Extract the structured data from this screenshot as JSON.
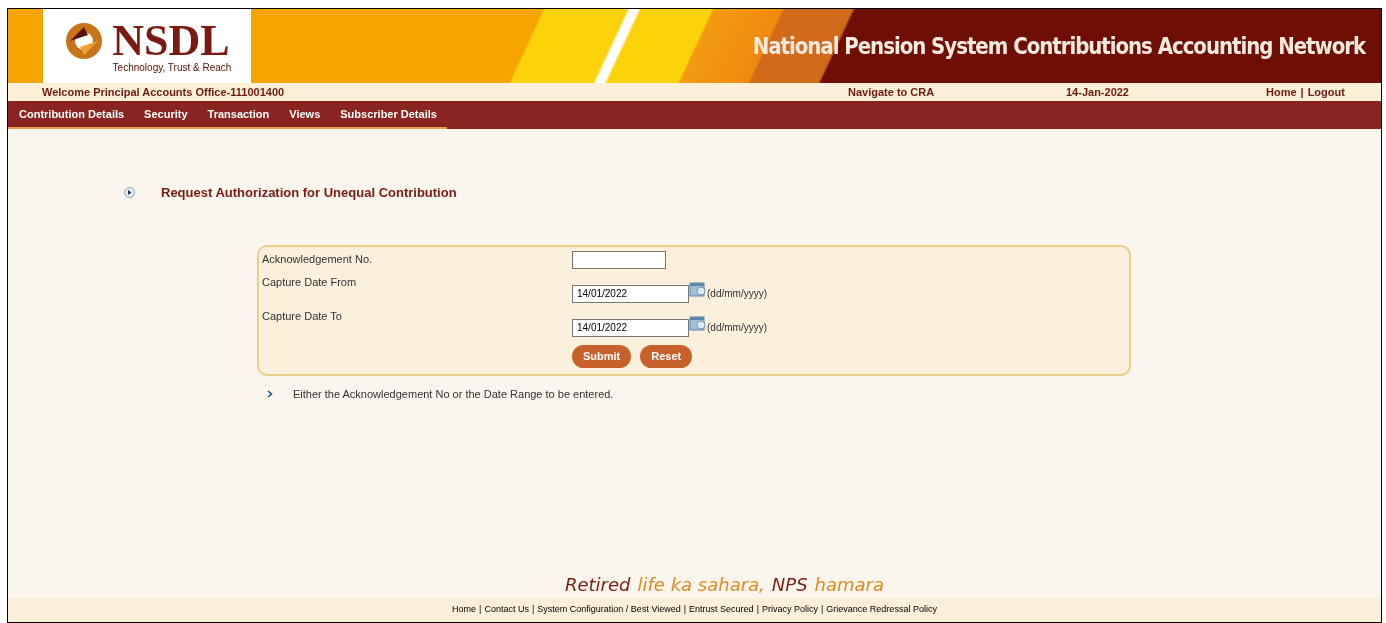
{
  "header": {
    "logo_text": "NSDL",
    "logo_tagline": "Technology, Trust & Reach",
    "title": "National Pension System Contributions Accounting Network"
  },
  "info_bar": {
    "welcome": "Welcome Principal Accounts Office-111001400",
    "navigate": "Navigate to CRA",
    "date": "14-Jan-2022",
    "links": [
      "Home",
      "Logout"
    ],
    "separator": "|"
  },
  "menu": [
    "Contribution Details",
    "Security",
    "Transaction",
    "Views",
    "Subscriber Details"
  ],
  "page_title": "Request Authorization for Unequal Contribution",
  "form": {
    "fields": [
      {
        "kind": "text",
        "label": "Acknowledgement No."
      },
      {
        "kind": "date",
        "label": "Capture Date From",
        "value": "14/01/2022",
        "hint": "(dd/mm/yyyy)"
      },
      {
        "kind": "date",
        "label": "Capture Date To",
        "value": "14/01/2022",
        "hint": "(dd/mm/yyyy)"
      }
    ],
    "buttons": [
      "Submit",
      "Reset"
    ]
  },
  "note": "Either the Acknowledgement No or the Date Range to be entered.",
  "tagline": [
    {
      "text": "Retired",
      "color": "#7a1f12"
    },
    {
      "text": "life ka sahara,",
      "color": "#e08a1e"
    },
    {
      "text": "NPS",
      "color": "#7a1f12"
    },
    {
      "text": "hamara",
      "color": "#e08a1e"
    }
  ],
  "footer": {
    "links": [
      "Home",
      "Contact Us",
      "System Configuration / Best Viewed",
      "Entrust Secured",
      "Privacy Policy",
      "Grievance Redressal Policy"
    ],
    "separator": "|"
  }
}
